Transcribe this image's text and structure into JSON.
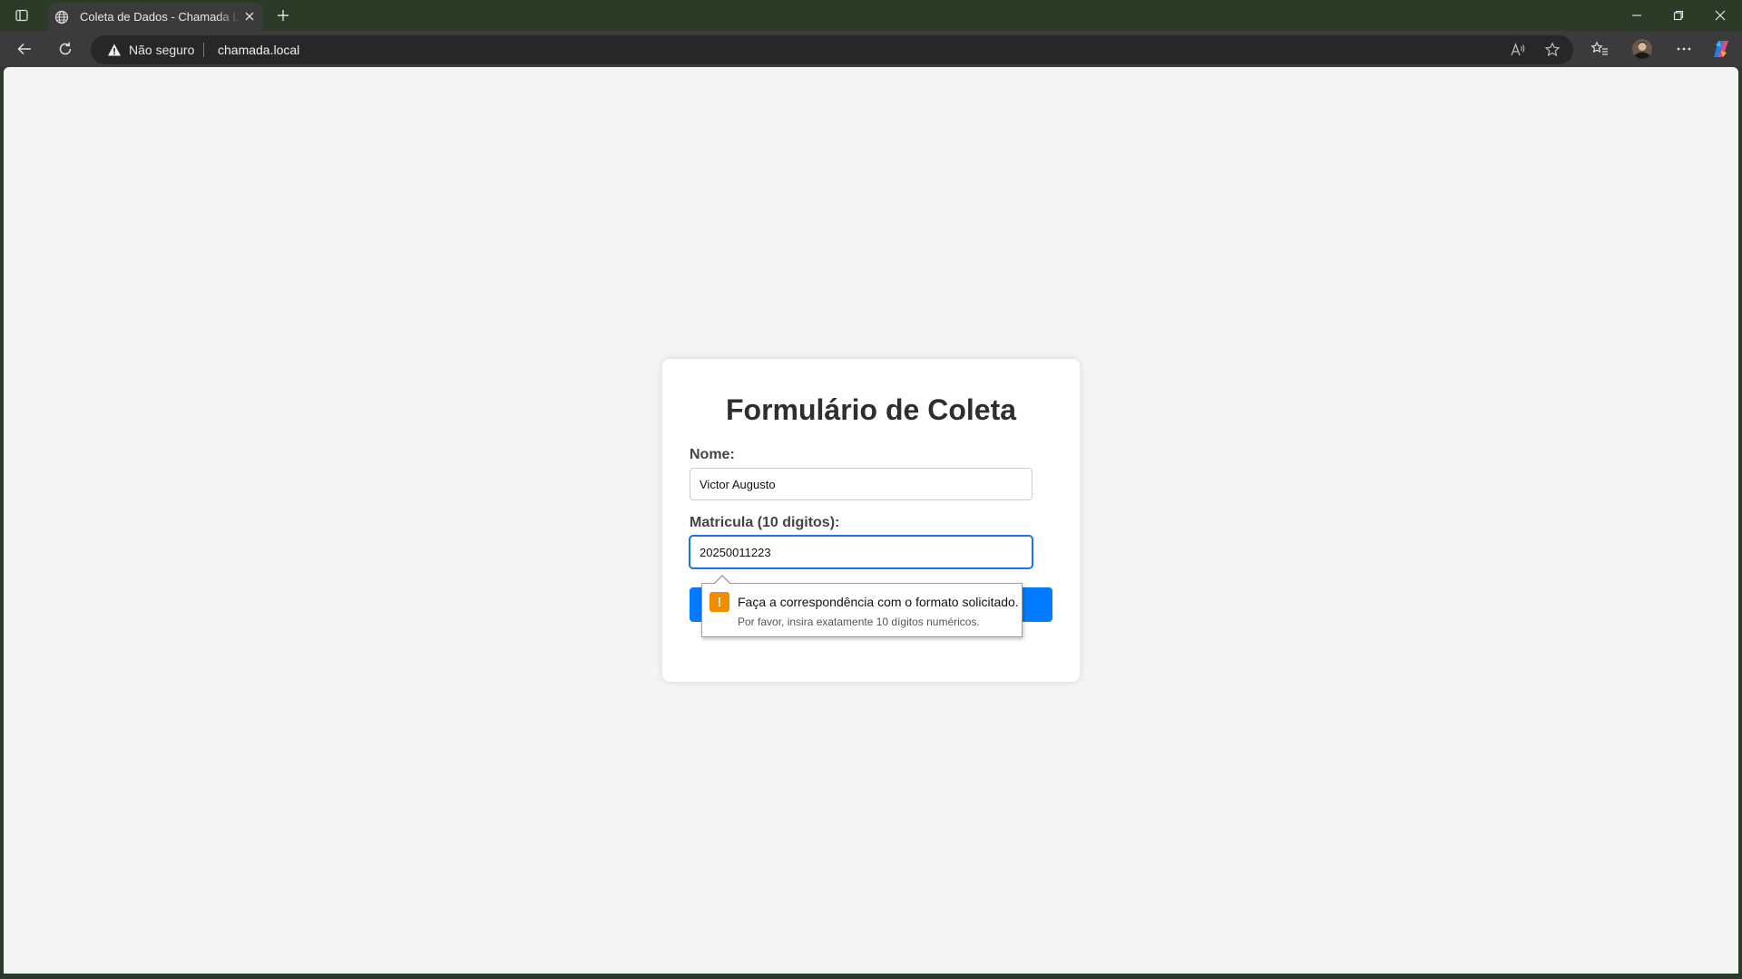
{
  "browser": {
    "tab_title": "Coleta de Dados - Chamada Local",
    "security_label": "Não seguro",
    "url": "chamada.local"
  },
  "form": {
    "title": "Formulário de Coleta",
    "name_label": "Nome:",
    "name_value": "Victor Augusto",
    "id_label": "Matricula (10 digitos):",
    "id_value": "20250011223",
    "submit_label": ""
  },
  "validation": {
    "message": "Faça a correspondência com o formato solicitado.",
    "hint": "Por favor, insira exatamente 10 dígitos numéricos."
  },
  "colors": {
    "accent": "#007bff",
    "warning": "#f08c00"
  }
}
